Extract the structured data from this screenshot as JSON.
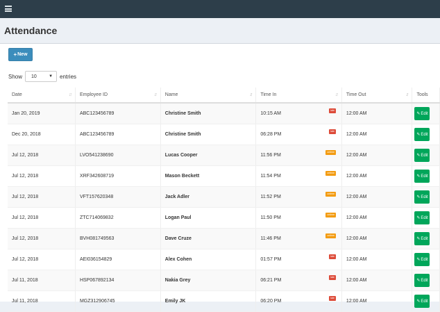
{
  "header": {
    "menu_icon": "hamburger-icon"
  },
  "page": {
    "title": "Attendance"
  },
  "toolbar": {
    "new_label": "New",
    "new_icon": "+"
  },
  "length": {
    "show_label": "Show",
    "entries_label": "entries",
    "value": "10"
  },
  "table": {
    "columns": [
      "Date",
      "Employee ID",
      "Name",
      "Time In",
      "Time Out",
      "Tools"
    ],
    "rows": [
      {
        "date": "Jan 20, 2019",
        "employee_id": "ABC123456789",
        "name": "Christine Smith",
        "time_in": "10:15 AM",
        "status": "late",
        "time_out": "12:00 AM"
      },
      {
        "date": "Dec 20, 2018",
        "employee_id": "ABC123456789",
        "name": "Christine Smith",
        "time_in": "06:28 PM",
        "status": "late",
        "time_out": "12:00 AM"
      },
      {
        "date": "Jul 12, 2018",
        "employee_id": "LVO541238690",
        "name": "Lucas Cooper",
        "time_in": "11:56 PM",
        "status": "ontime",
        "time_out": "12:00 AM"
      },
      {
        "date": "Jul 12, 2018",
        "employee_id": "XRF342608719",
        "name": "Mason Beckett",
        "time_in": "11:54 PM",
        "status": "ontime",
        "time_out": "12:00 AM"
      },
      {
        "date": "Jul 12, 2018",
        "employee_id": "VFT157620348",
        "name": "Jack Adler",
        "time_in": "11:52 PM",
        "status": "ontime",
        "time_out": "12:00 AM"
      },
      {
        "date": "Jul 12, 2018",
        "employee_id": "ZTC714069832",
        "name": "Logan Paul",
        "time_in": "11:50 PM",
        "status": "ontime",
        "time_out": "12:00 AM"
      },
      {
        "date": "Jul 12, 2018",
        "employee_id": "BVH081749563",
        "name": "Dave Cruze",
        "time_in": "11:46 PM",
        "status": "ontime",
        "time_out": "12:00 AM"
      },
      {
        "date": "Jul 12, 2018",
        "employee_id": "AEI036154829",
        "name": "Alex Cohen",
        "time_in": "01:57 PM",
        "status": "late",
        "time_out": "12:00 AM"
      },
      {
        "date": "Jul 11, 2018",
        "employee_id": "HSP067892134",
        "name": "Nakia Grey",
        "time_in": "06:21 PM",
        "status": "late",
        "time_out": "12:00 AM"
      },
      {
        "date": "Jul 11, 2018",
        "employee_id": "MGZ312906745",
        "name": "Emily JK",
        "time_in": "06:20 PM",
        "status": "late",
        "time_out": "12:00 AM"
      }
    ],
    "status_labels": {
      "late": "late",
      "ontime": "ontime"
    },
    "edit_label": "Edit"
  },
  "colors": {
    "late": "#dd4b39",
    "ontime": "#f39c12",
    "edit": "#00a65a",
    "primary": "#3c8dbc",
    "topbar": "#2d3e4a"
  }
}
